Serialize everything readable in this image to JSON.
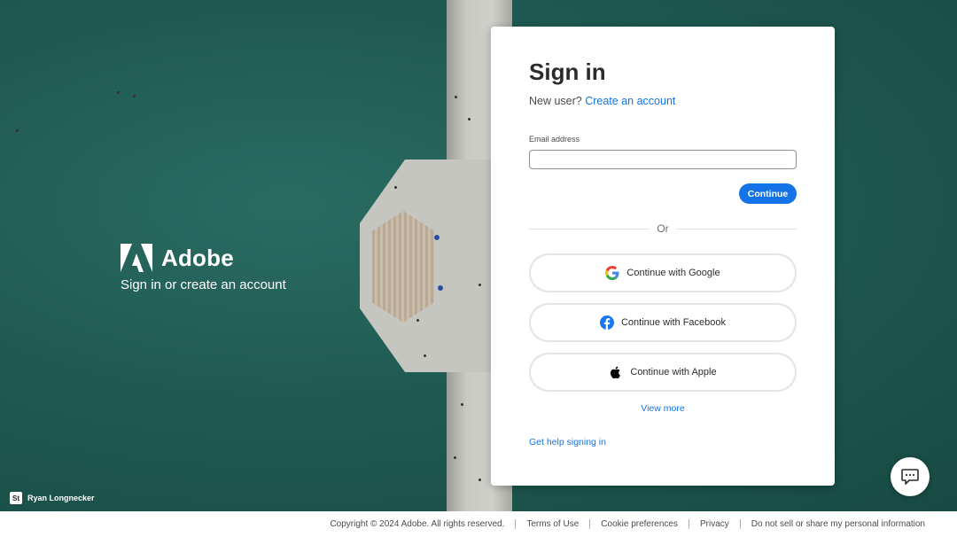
{
  "brand": {
    "name": "Adobe",
    "tagline": "Sign in or create an account",
    "logo_icon": "adobe-logo-icon"
  },
  "credit": {
    "badge": "St",
    "photographer": "Ryan Longnecker"
  },
  "signin": {
    "title": "Sign in",
    "new_user_text": "New user?",
    "create_account_link": "Create an account",
    "email_label": "Email address",
    "email_value": "",
    "continue_label": "Continue",
    "divider_text": "Or",
    "social": [
      {
        "label": "Continue with Google",
        "icon": "google-icon"
      },
      {
        "label": "Continue with Facebook",
        "icon": "facebook-icon"
      },
      {
        "label": "Continue with Apple",
        "icon": "apple-icon"
      }
    ],
    "view_more": "View more",
    "help_link": "Get help signing in"
  },
  "chat": {
    "icon": "chat-icon"
  },
  "footer": {
    "copyright": "Copyright © 2024 Adobe. All rights reserved.",
    "links": [
      "Terms of Use",
      "Cookie preferences",
      "Privacy",
      "Do not sell or share my personal information"
    ]
  },
  "colors": {
    "accent": "#1473e6",
    "ocean": "#1f5a52",
    "text_dark": "#2c2c2c"
  }
}
